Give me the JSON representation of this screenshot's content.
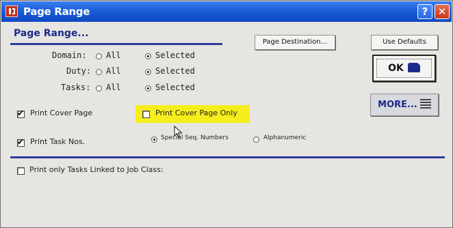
{
  "window": {
    "title": "Page Range",
    "help_glyph": "?",
    "close_glyph": "✕"
  },
  "heading": "Page Range...",
  "buttons": {
    "page_destination": "Page Destination...",
    "use_defaults": "Use Defaults",
    "ok": "OK",
    "more": "MORE..."
  },
  "ranges": [
    {
      "label": "Domain:",
      "all": "All",
      "selected": "Selected",
      "value": "Selected"
    },
    {
      "label": "Duty:",
      "all": "All",
      "selected": "Selected",
      "value": "Selected"
    },
    {
      "label": "Tasks:",
      "all": "All",
      "selected": "Selected",
      "value": "Selected"
    }
  ],
  "options": {
    "print_cover_page": {
      "label": "Print Cover Page",
      "checked": true
    },
    "print_cover_page_only": {
      "label": "Print Cover Page Only",
      "checked": false
    },
    "print_task_nos": {
      "label": "Print Task Nos.",
      "checked": true
    },
    "numbering": {
      "special": "Special Seq. Numbers",
      "alpha": "Alphanumeric",
      "value": "special"
    },
    "print_only_linked": {
      "label": "Print only Tasks Linked to Job Class:",
      "checked": false
    }
  },
  "colors": {
    "title_bar": "#1c5ed8",
    "accent": "#2d3c9c",
    "highlight": "#f5ee1c"
  }
}
